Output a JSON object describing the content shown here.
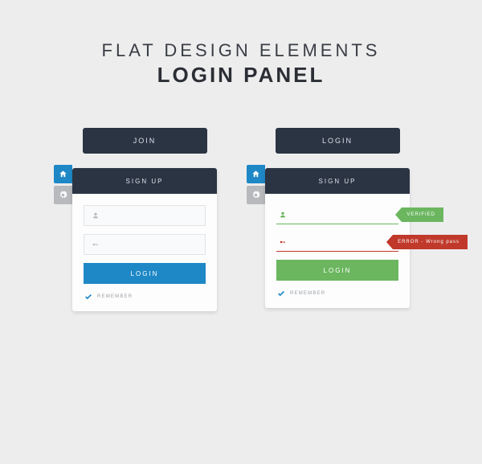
{
  "heading": {
    "line1": "FLAT DESIGN ELEMENTS",
    "line2": "LOGIN PANEL"
  },
  "panels": {
    "left": {
      "top_button": "JOIN",
      "header": "SIGN UP",
      "submit": "LOGIN",
      "remember": "REMEMBER"
    },
    "right": {
      "top_button": "LOGIN",
      "header": "SIGN UP",
      "submit": "LOGIN",
      "remember": "REMEMBER",
      "badge_ok": "VERIFIED",
      "badge_err": "ERROR - Wrong pass"
    }
  },
  "colors": {
    "dark": "#2b3443",
    "blue": "#1e88c6",
    "green": "#6bb65f",
    "red": "#c0392b",
    "bg": "#ededee"
  }
}
